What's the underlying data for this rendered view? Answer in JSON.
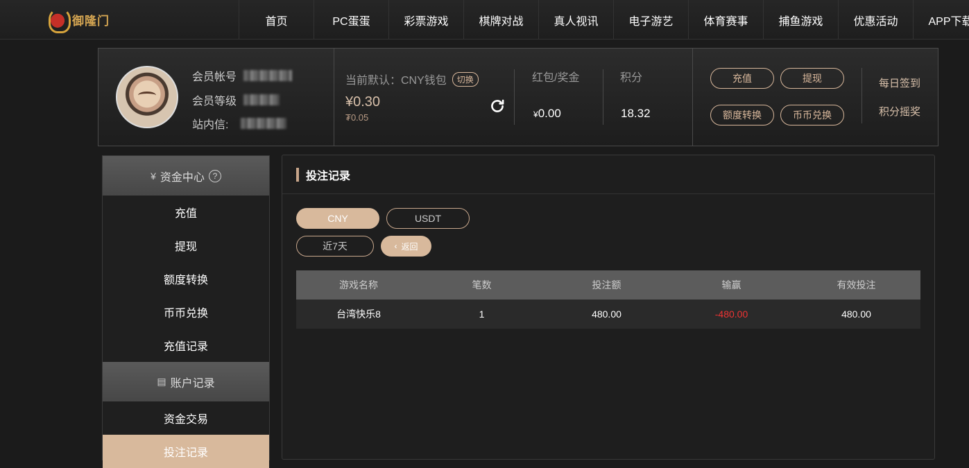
{
  "brand": {
    "logo_text": "御隆门"
  },
  "nav": {
    "items": [
      {
        "label": "首页"
      },
      {
        "label": "PC蛋蛋"
      },
      {
        "label": "彩票游戏"
      },
      {
        "label": "棋牌对战"
      },
      {
        "label": "真人视讯"
      },
      {
        "label": "电子游艺"
      },
      {
        "label": "体育赛事"
      },
      {
        "label": "捕鱼游戏"
      },
      {
        "label": "优惠活动"
      },
      {
        "label": "APP下载"
      }
    ]
  },
  "profile": {
    "account_label": "会员帐号",
    "level_label": "会员等级",
    "messages_label": "站内信:",
    "wallet_label": "当前默认：CNY钱包",
    "switch_label": "切换",
    "wallet_amount": "¥0.30",
    "wallet_sub": "₮0.05",
    "redpack_label": "红包/奖金",
    "redpack_currency": "¥",
    "redpack_value": "0.00",
    "points_label": "积分",
    "points_value": "18.32",
    "buttons": {
      "deposit": "充值",
      "withdraw": "提现",
      "transfer": "额度转换",
      "coin_exchange": "币币兑换"
    },
    "daily_signin": "每日签到",
    "points_lottery": "积分摇奖"
  },
  "sidebar": {
    "funds_header": "资金中心",
    "funds_items": [
      {
        "label": "充值"
      },
      {
        "label": "提现"
      },
      {
        "label": "额度转换"
      },
      {
        "label": "币币兑换"
      },
      {
        "label": "充值记录"
      }
    ],
    "records_header": "账户记录",
    "records_items": [
      {
        "label": "资金交易"
      },
      {
        "label": "投注记录"
      }
    ]
  },
  "panel": {
    "title": "投注记录",
    "currency_tabs": [
      {
        "label": "CNY",
        "active": true
      },
      {
        "label": "USDT",
        "active": false
      }
    ],
    "range_label": "近7天",
    "back_label": "返回",
    "table": {
      "headers": [
        "游戏名称",
        "笔数",
        "投注额",
        "输赢",
        "有效投注"
      ],
      "rows": [
        [
          "台湾快乐8",
          "1",
          "480.00",
          "-480.00",
          "480.00"
        ]
      ]
    }
  },
  "colors": {
    "accent": "#d8b99c",
    "negative": "#e33333",
    "background": "#1b1b1b"
  }
}
